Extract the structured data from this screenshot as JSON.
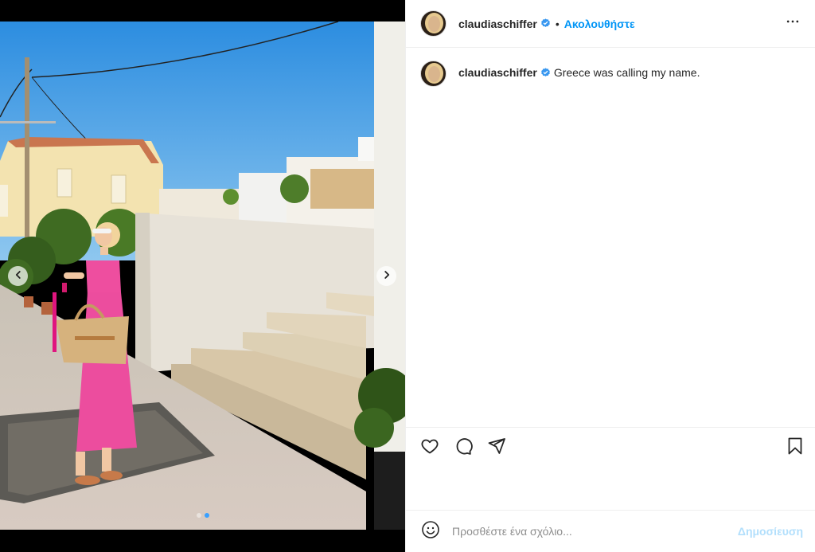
{
  "post": {
    "username": "claudiaschiffer",
    "separator": "•",
    "follow_label": "Ακολουθήστε",
    "caption": "Greece was calling my name."
  },
  "media": {
    "description_icons": [
      "chevron-left-icon",
      "chevron-right-icon"
    ],
    "carousel_count": 2,
    "carousel_active": 1
  },
  "actions": {
    "icons": [
      "heart-icon",
      "comment-icon",
      "share-icon",
      "bookmark-icon"
    ]
  },
  "comment": {
    "placeholder": "Προσθέστε ένα σχόλιο...",
    "post_label": "Δημοσίευση"
  },
  "colors": {
    "accent": "#0095f6",
    "post_disabled": "#b2dffc",
    "verified": "#3897f0",
    "carousel_active": "#3aa0ff"
  }
}
